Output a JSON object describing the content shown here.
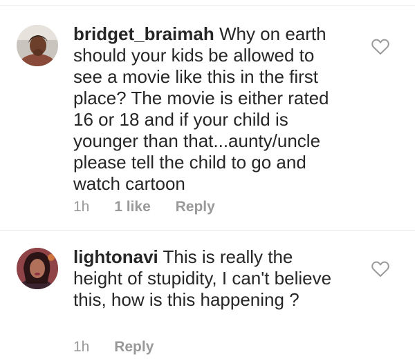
{
  "comments": [
    {
      "username": "bridget_braimah",
      "text": "Why on earth should your kids be allowed to see a movie like this in the first place? The movie is either rated 16 or 18 and if your child is younger than that...aunty/uncle please tell the child to go and watch cartoon",
      "time": "1h",
      "likes": "1 like",
      "reply": "Reply",
      "like_icon": "heart-outline-icon"
    },
    {
      "username": "lightonavi",
      "text": "This is really the height of stupidity, I can't believe this, how is this happening ?",
      "time": "1h",
      "reply": "Reply",
      "like_icon": "heart-outline-icon"
    }
  ]
}
